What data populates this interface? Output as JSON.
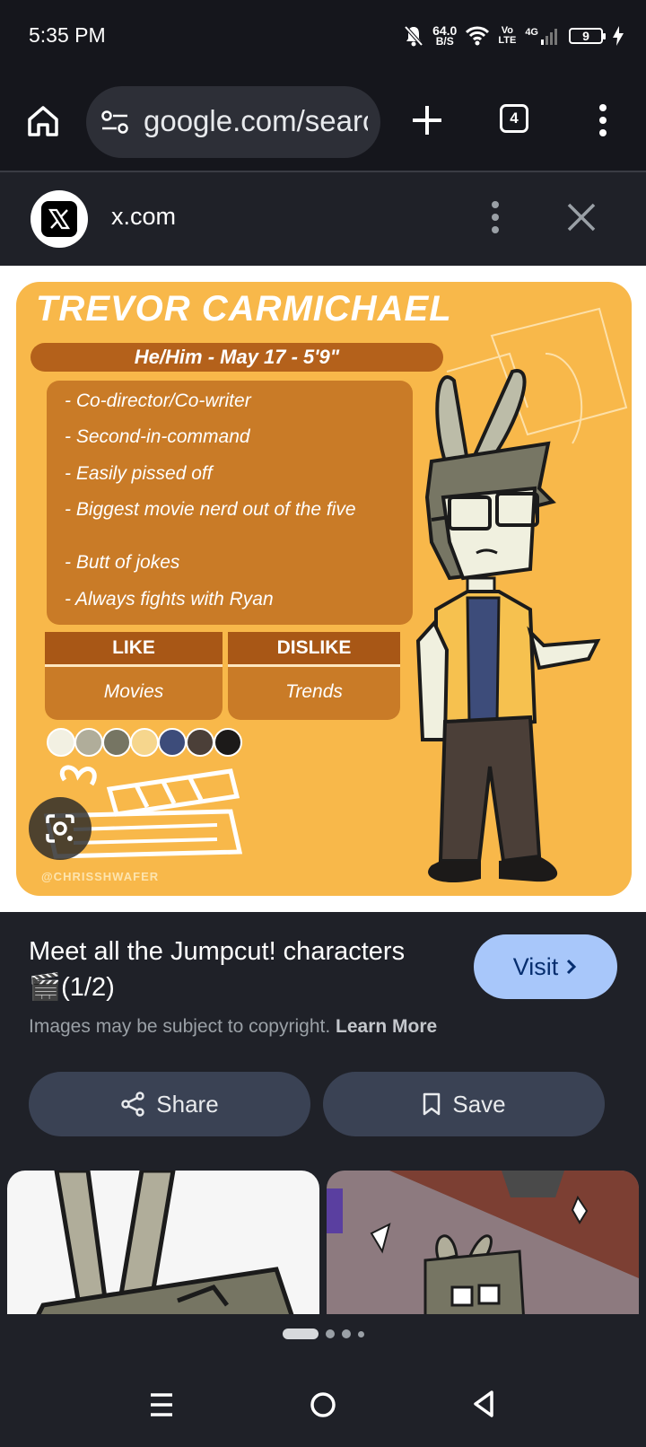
{
  "status_bar": {
    "time": "5:35 PM",
    "net_speed_value": "64.0",
    "net_speed_unit": "B/S",
    "volte_top": "Vo",
    "volte_bottom": "LTE",
    "network": "4G",
    "battery": "9"
  },
  "browser": {
    "url": "google.com/search",
    "tab_count": "4"
  },
  "source": {
    "site": "x.com"
  },
  "image": {
    "name": "TREVOR CARMICHAEL",
    "info_line": "He/Him - May 17 - 5'9\"",
    "traits": [
      "- Co-director/Co-writer",
      "- Second-in-command",
      "- Easily pissed off",
      "- Biggest movie nerd out of the five",
      "- Butt of jokes",
      "- Always fights with Ryan"
    ],
    "like_label": "LIKE",
    "like_value": "Movies",
    "dislike_label": "DISLIKE",
    "dislike_value": "Trends",
    "palette": [
      "#f2f0e2",
      "#b0ad9a",
      "#767563",
      "#f6d68d",
      "#3d4c7a",
      "#4b3f38",
      "#1c1a19"
    ],
    "credit": "@CHRISSHWAFER"
  },
  "info": {
    "title": "Meet all the Jumpcut! characters 🎬(1/2)",
    "visit_label": "Visit",
    "copyright_text": "Images may be subject to copyright.",
    "learn_more": "Learn More",
    "share_label": "Share",
    "save_label": "Save"
  }
}
